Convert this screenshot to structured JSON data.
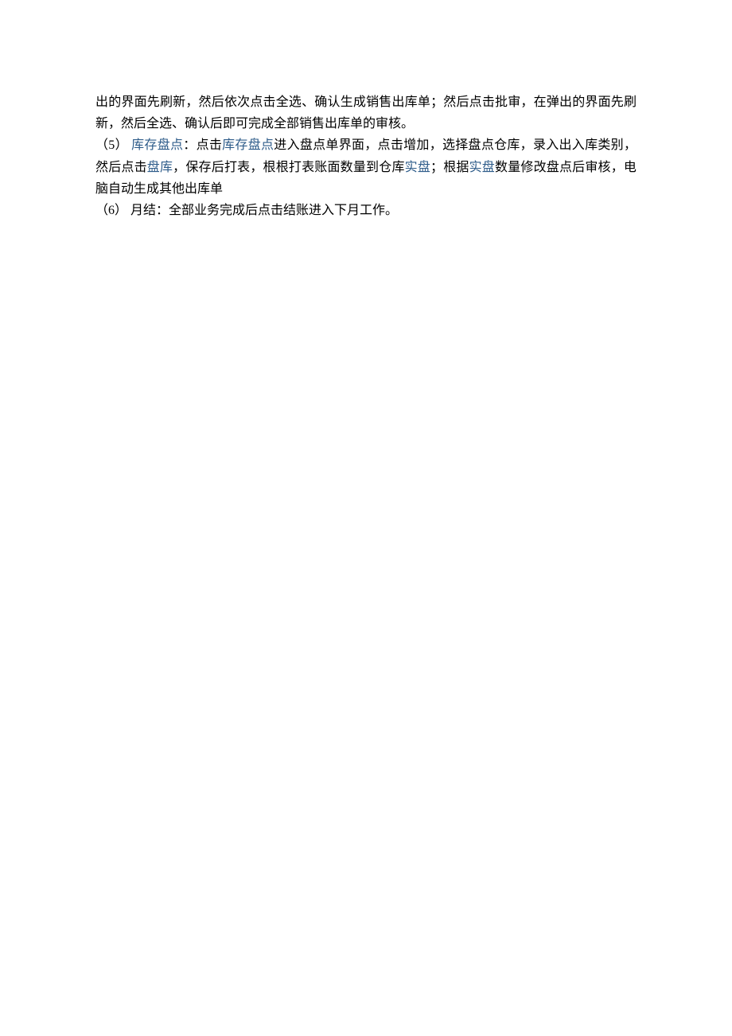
{
  "paragraphs": {
    "p1": {
      "t1": "出的界面先刷新，然后依次点击全选、确认生成销售出库单；然后点击批审，在弹出的界面先刷新，然后全选、确认后即可完成全部销售出库单的审核。"
    },
    "p2": {
      "marker": "（5） ",
      "link1": "库存盘点",
      "t1": "：点击",
      "link2": "库存盘点",
      "t2": "进入盘点单界面，点击增加，选择盘点仓库，录入出入库类别，然后点击",
      "link3": "盘库",
      "t3": "，保存后打表，根根打表账面数量到仓库",
      "link4": "实盘",
      "t4": "；根据",
      "link5": "实盘",
      "t5": "数量修改盘点后审核，电脑自动生成其他出库单"
    },
    "p3": {
      "marker": "（6） ",
      "t1": "月结：全部业务完成后点击结账进入下月工作。"
    }
  }
}
